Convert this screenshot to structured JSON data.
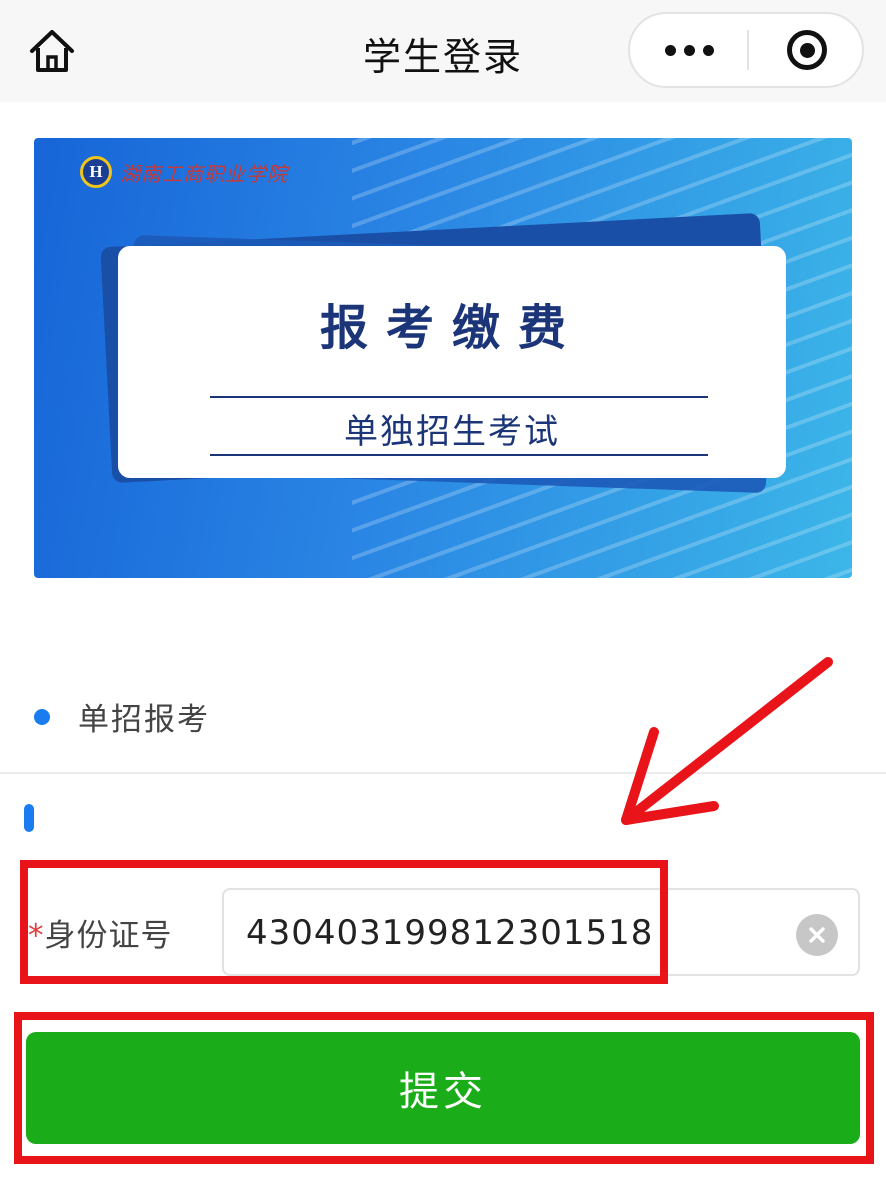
{
  "navbar": {
    "title": "学生登录",
    "home_icon": "home-icon",
    "more_icon": "more-dots-icon",
    "close_icon": "target-circle-icon"
  },
  "banner": {
    "logo_letter": "H",
    "logo_text": "湖南工商职业学院",
    "title": "报考缴费",
    "subtitle": "单独招生考试"
  },
  "section": {
    "item_label": "单招报考"
  },
  "form": {
    "required_mark": "*",
    "id_label": "身份证号",
    "id_value": "430403199812301518",
    "clear_icon": "clear-circle-icon"
  },
  "actions": {
    "submit_label": "提交"
  },
  "colors": {
    "accent_blue": "#1a7cf0",
    "submit_green": "#1aad19",
    "annotation_red": "#e8141a",
    "banner_navy": "#1b3578"
  }
}
